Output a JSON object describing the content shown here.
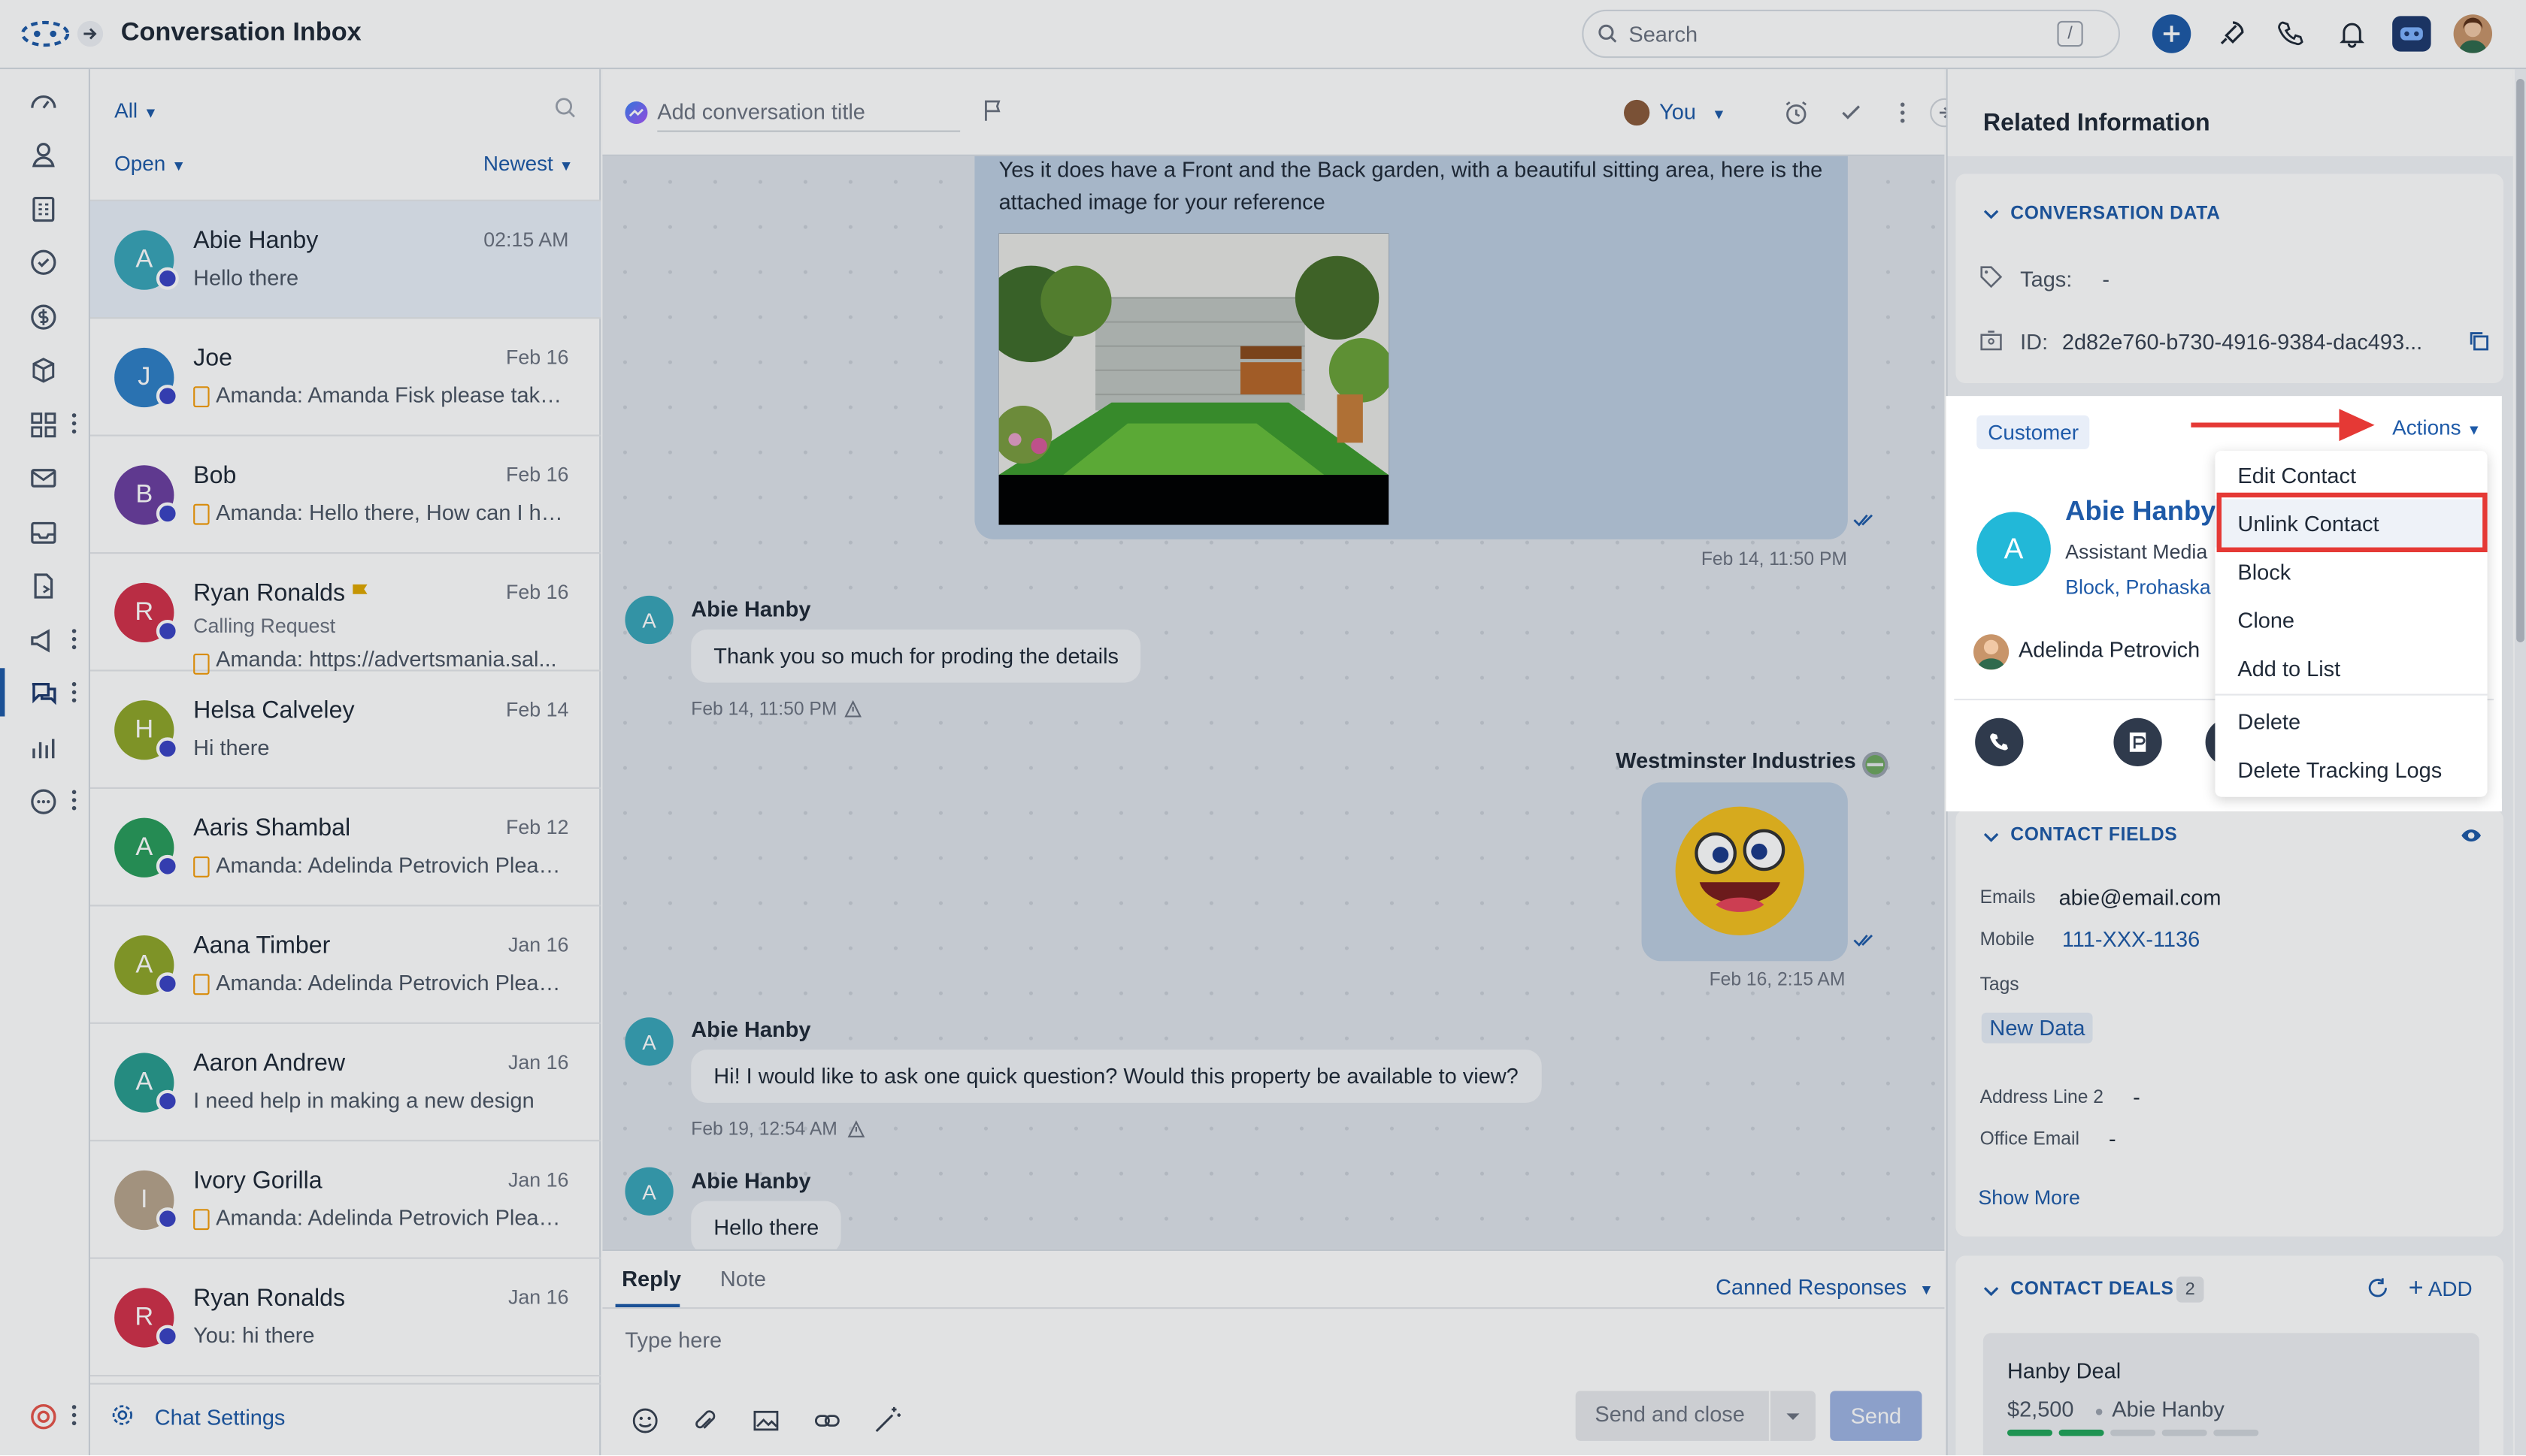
{
  "app": {
    "title": "Conversation Inbox"
  },
  "search": {
    "placeholder": "Search",
    "shortcut": "/"
  },
  "conv_filters": {
    "scope": "All",
    "status": "Open",
    "sort": "Newest"
  },
  "conversations": [
    {
      "initial": "A",
      "name": "Abie Hanby",
      "date": "02:15 AM",
      "preview": "Hello there",
      "color": "#3aa6b9",
      "channel": "messenger"
    },
    {
      "initial": "J",
      "name": "Joe",
      "date": "Feb 16",
      "preview": "Amanda: Amanda Fisk please take...",
      "color": "#2f80c6",
      "channel": "chat"
    },
    {
      "initial": "B",
      "name": "Bob",
      "date": "Feb 16",
      "preview": "Amanda: Hello there, How can I help ...",
      "color": "#6b3fa0",
      "channel": "chat"
    },
    {
      "initial": "R",
      "name": "Ryan Ronalds",
      "date": "Feb 16",
      "sub": "Calling Request",
      "preview": "Amanda: https://advertsmania.sal...",
      "color": "#d2314b",
      "channel": "chat"
    },
    {
      "initial": "H",
      "name": "Helsa Calveley",
      "date": "Feb 14",
      "preview": "Hi there",
      "color": "#8fa62a",
      "channel": "messenger"
    },
    {
      "initial": "A",
      "name": "Aaris Shambal",
      "date": "Feb 12",
      "preview": "Amanda: Adelinda Petrovich Pleas...",
      "color": "#2a9d5c",
      "channel": "chat"
    },
    {
      "initial": "A",
      "name": "Aana Timber",
      "date": "Jan 16",
      "preview": "Amanda: Adelinda Petrovich Pleas...",
      "color": "#8fa62a",
      "channel": "chat"
    },
    {
      "initial": "A",
      "name": "Aaron Andrew",
      "date": "Jan 16",
      "preview": "I need help in making a new design",
      "color": "#2a9d8f",
      "channel": "chat"
    },
    {
      "initial": "I",
      "name": "Ivory Gorilla",
      "date": "Jan 16",
      "preview": "Amanda: Adelinda Petrovich Pleas...",
      "color": "#b8a48c",
      "channel": "chat"
    },
    {
      "initial": "R",
      "name": "Ryan Ronalds",
      "date": "Jan 16",
      "preview": "You: hi there",
      "color": "#d2314b",
      "channel": "chat"
    }
  ],
  "chat_settings": "Chat Settings",
  "chat_header": {
    "title_placeholder": "Add conversation title",
    "assignee": "You"
  },
  "messages": {
    "out1_text": "Yes it does have a Front and the Back garden, with a beautiful sitting area, here is the attached image for your reference",
    "out1_time": "Feb 14, 11:50 PM",
    "in1_name": "Abie Hanby",
    "in1_text": "Thank you so much for proding the details",
    "in1_time": "Feb 14, 11:50 PM",
    "out2_sender": "Westminster Industries",
    "out2_time": "Feb 16, 2:15 AM",
    "in2_name": "Abie Hanby",
    "in2_text": "Hi! I would like to ask one quick question? Would this property be available to view?",
    "in2_time": "Feb 19, 12:54 AM",
    "in3_name": "Abie Hanby",
    "in3_text": "Hello there"
  },
  "composer": {
    "tab_reply": "Reply",
    "tab_note": "Note",
    "canned": "Canned Responses",
    "placeholder": "Type here",
    "send_close": "Send and close",
    "send": "Send"
  },
  "right_panel": {
    "title": "Related Information",
    "conv_data_title": "CONVERSATION DATA",
    "tags_label": "Tags:",
    "tags_value": "-",
    "id_label": "ID:",
    "id_value": "2d82e760-b730-4916-9384-dac493...",
    "customer_tab": "Customer",
    "actions": "Actions",
    "contact_initial": "A",
    "contact_name": "Abie Hanby",
    "contact_role": "Assistant Media",
    "contact_company": "Block, Prohaska",
    "owner": "Adelinda Petrovich",
    "contact_fields_title": "CONTACT FIELDS",
    "emails_label": "Emails",
    "emails_value": "abie@email.com",
    "mobile_label": "Mobile",
    "mobile_value": "111-XXX-1136",
    "tags2_label": "Tags",
    "tags2_value": "New Data",
    "addr_label": "Address Line 2",
    "addr_value": "-",
    "office_label": "Office Email",
    "office_value": "-",
    "show_more": "Show More",
    "deals_title": "CONTACT DEALS",
    "deals_count": "2",
    "deals_add": "ADD",
    "deal_name": "Hanby Deal",
    "deal_amount": "$2,500",
    "deal_contact": "Abie Hanby"
  },
  "actions_menu": [
    "Edit Contact",
    "Unlink Contact",
    "Block",
    "Clone",
    "Add to List",
    "Delete",
    "Delete Tracking Logs"
  ],
  "colors": {
    "accent": "#1e5aa8",
    "highlight_box": "#e53935",
    "arrow": "#e53935"
  }
}
